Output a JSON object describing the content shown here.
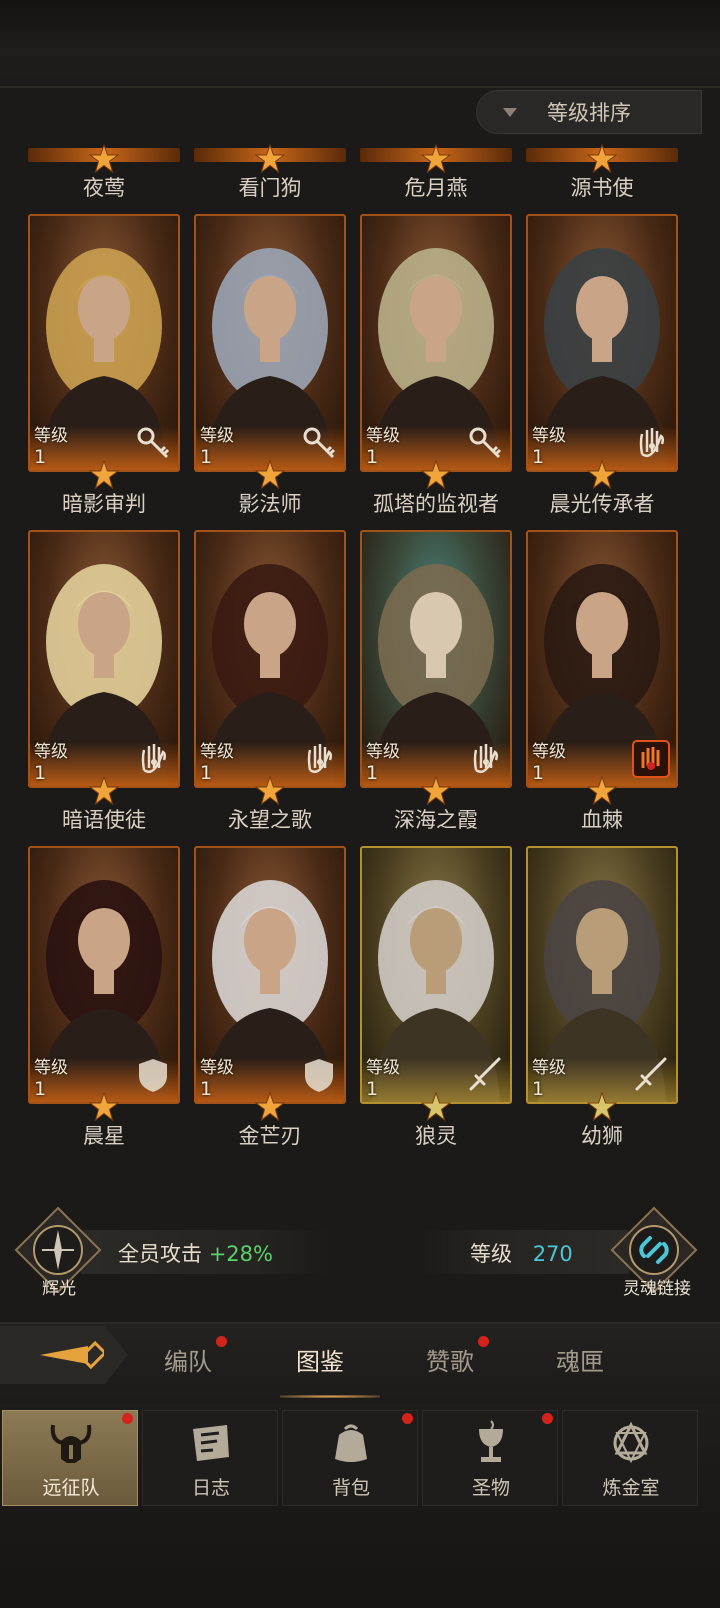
{
  "sort": {
    "label": "等级排序"
  },
  "cards": [
    {
      "name": "夜莺",
      "type": "partial"
    },
    {
      "name": "看门狗",
      "type": "partial"
    },
    {
      "name": "危月燕",
      "type": "partial"
    },
    {
      "name": "源书使",
      "type": "partial"
    },
    {
      "name": "暗影审判",
      "level_label": "等级",
      "level": "1",
      "class_icon": "key-icon",
      "theme": "orange"
    },
    {
      "name": "影法师",
      "level_label": "等级",
      "level": "1",
      "class_icon": "key-icon",
      "theme": "orange"
    },
    {
      "name": "孤塔的监视者",
      "level_label": "等级",
      "level": "1",
      "class_icon": "key-icon",
      "theme": "orange"
    },
    {
      "name": "晨光传承者",
      "level_label": "等级",
      "level": "1",
      "class_icon": "hand-icon",
      "theme": "orange"
    },
    {
      "name": "暗语使徒",
      "level_label": "等级",
      "level": "1",
      "class_icon": "hand-icon",
      "theme": "orange"
    },
    {
      "name": "永望之歌",
      "level_label": "等级",
      "level": "1",
      "class_icon": "hand-icon",
      "theme": "orange"
    },
    {
      "name": "深海之霞",
      "level_label": "等级",
      "level": "1",
      "class_icon": "hand-icon",
      "theme": "teal"
    },
    {
      "name": "血棘",
      "level_label": "等级",
      "level": "1",
      "class_icon": "blood-hand-icon",
      "theme": "orange"
    },
    {
      "name": "晨星",
      "level_label": "等级",
      "level": "1",
      "class_icon": "shield-icon",
      "theme": "orange"
    },
    {
      "name": "金芒刃",
      "level_label": "等级",
      "level": "1",
      "class_icon": "shield-icon",
      "theme": "orange"
    },
    {
      "name": "狼灵",
      "level_label": "等级",
      "level": "1",
      "class_icon": "sword-icon",
      "theme": "gold"
    },
    {
      "name": "幼狮",
      "level_label": "等级",
      "level": "1",
      "class_icon": "sword-icon",
      "theme": "gold"
    }
  ],
  "stats": {
    "left_badge": "辉光",
    "attack_label": "全员攻击",
    "attack_value": "+28%",
    "level_label": "等级",
    "level_value": "270",
    "right_badge": "灵魂链接"
  },
  "tabs": [
    {
      "label": "编队",
      "badge": true
    },
    {
      "label": "图鉴",
      "badge": false,
      "active": true
    },
    {
      "label": "赞歌",
      "badge": true
    },
    {
      "label": "魂匣",
      "badge": false
    }
  ],
  "nav": [
    {
      "label": "远征队",
      "icon": "horned-helmet-icon",
      "active": true,
      "badge": true
    },
    {
      "label": "日志",
      "icon": "scroll-icon",
      "badge": false
    },
    {
      "label": "背包",
      "icon": "bag-icon",
      "badge": true
    },
    {
      "label": "圣物",
      "icon": "chalice-icon",
      "badge": true
    },
    {
      "label": "炼金室",
      "icon": "alchemy-icon",
      "badge": false
    }
  ],
  "colors": {
    "accent_green": "#58d36a",
    "accent_cyan": "#4bc8d8",
    "badge_red": "#d2231d",
    "card_border": "#a3531a"
  }
}
